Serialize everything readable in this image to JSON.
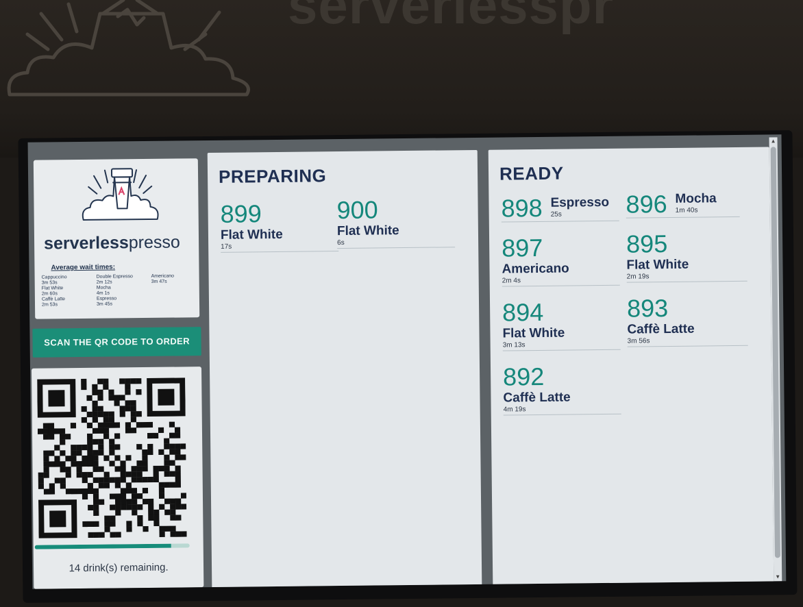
{
  "sign": {
    "text": "serverlesspr"
  },
  "brand": {
    "name_bold": "serverless",
    "name_light": "presso",
    "wait_title": "Average wait times:",
    "wait_times": [
      {
        "drink": "Cappuccino",
        "time": "3m 53s"
      },
      {
        "drink": "Double Espresso",
        "time": "2m 12s"
      },
      {
        "drink": "Americano",
        "time": "3m 47s"
      },
      {
        "drink": "Flat White",
        "time": "2m 60s"
      },
      {
        "drink": "Mocha",
        "time": "4m 1s"
      },
      {
        "drink": "",
        "time": ""
      },
      {
        "drink": "Caffè Latte",
        "time": "2m 53s"
      },
      {
        "drink": "Espresso",
        "time": "3m 45s"
      },
      {
        "drink": "",
        "time": ""
      }
    ]
  },
  "scan_button": {
    "label": "SCAN THE QR CODE TO ORDER"
  },
  "qr": {
    "remaining_text": "14 drink(s) remaining.",
    "progress": 0.88
  },
  "preparing": {
    "title": "PREPARING",
    "orders": [
      {
        "number": "899",
        "drink": "Flat White",
        "time": "17s"
      },
      {
        "number": "900",
        "drink": "Flat White",
        "time": "6s"
      }
    ]
  },
  "ready": {
    "title": "READY",
    "orders": [
      {
        "number": "898",
        "drink": "Espresso",
        "time": "25s"
      },
      {
        "number": "896",
        "drink": "Mocha",
        "time": "1m 40s"
      },
      {
        "number": "897",
        "drink": "Americano",
        "time": "2m 4s"
      },
      {
        "number": "895",
        "drink": "Flat White",
        "time": "2m 19s"
      },
      {
        "number": "894",
        "drink": "Flat White",
        "time": "3m 13s"
      },
      {
        "number": "893",
        "drink": "Caffè Latte",
        "time": "3m 56s"
      },
      {
        "number": "892",
        "drink": "Caffè Latte",
        "time": "4m 19s"
      }
    ]
  },
  "colors": {
    "accent_teal": "#15877b",
    "navy": "#1f2f52",
    "button_green": "#1b8e78"
  }
}
